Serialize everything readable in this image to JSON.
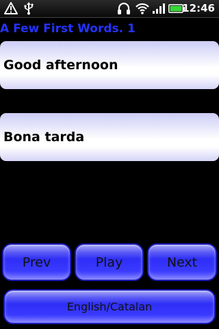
{
  "status_bar": {
    "icons": [
      "warning-icon",
      "usb-icon",
      "headset-icon",
      "wifi-icon",
      "signal-icon",
      "battery-icon"
    ],
    "time": "12:46"
  },
  "app": {
    "title": "A Few First Words. 1"
  },
  "phrases": {
    "english": "Good afternoon",
    "catalan": "Bona tarda"
  },
  "controls": {
    "prev_label": "Prev",
    "play_label": "Play",
    "next_label": "Next",
    "language_label": "English/Catalan"
  },
  "colors": {
    "title": "#2433ff",
    "button": "#2f2ff8",
    "panel": "#e8e8fb",
    "background": "#000000"
  }
}
